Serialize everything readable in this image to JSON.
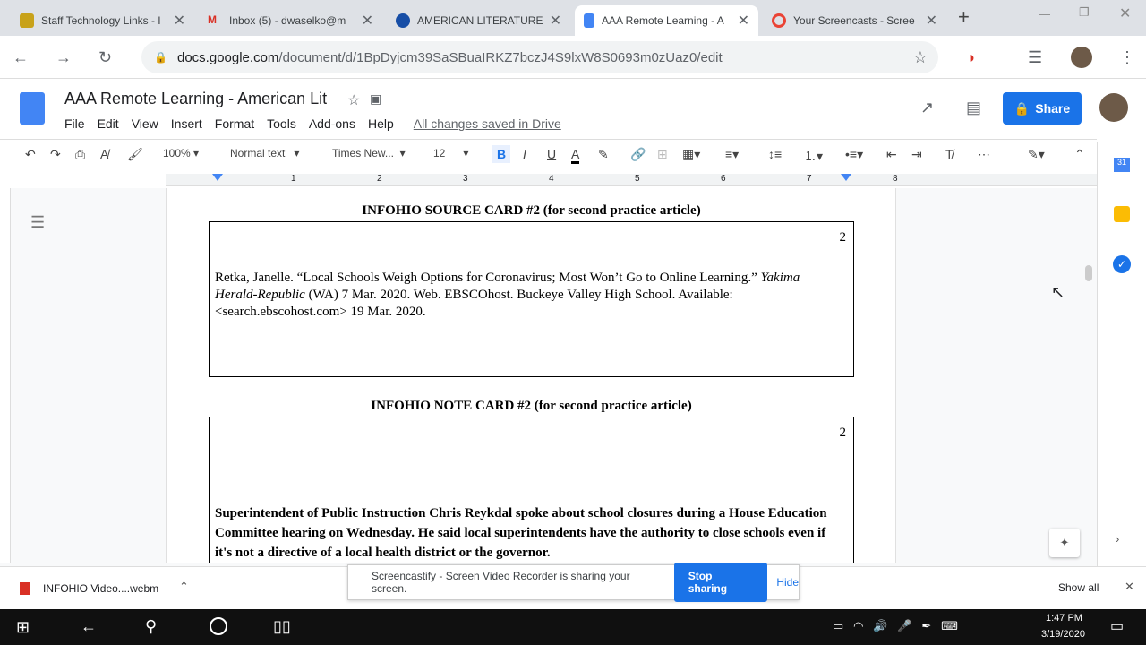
{
  "browser": {
    "tabs": [
      {
        "title": "Staff Technology Links - I",
        "color": "#c8a21a"
      },
      {
        "title": "Inbox (5) - dwaselko@m",
        "color": "#d93025"
      },
      {
        "title": "AMERICAN LITERATURE",
        "color": "#174ea6"
      },
      {
        "title": "AAA Remote Learning - A",
        "color": "#4285f4",
        "active": true
      },
      {
        "title": "Your Screencasts - Scree",
        "color": "#ea4335"
      }
    ],
    "url_host": "docs.google.com",
    "url_path": "/document/d/1BpDyjcm39SaSBuaIRKZ7bczJ4S9lxW8S0693m0zUaz0/edit"
  },
  "doc": {
    "title": "AAA Remote Learning - American Lit",
    "menu": [
      "File",
      "Edit",
      "View",
      "Insert",
      "Format",
      "Tools",
      "Add-ons",
      "Help"
    ],
    "saved": "All changes saved in Drive",
    "share": "Share",
    "toolbar": {
      "zoom": "100%",
      "style": "Normal text",
      "font": "Times New...",
      "size": "12"
    },
    "ruler": [
      "1",
      "2",
      "3",
      "4",
      "5",
      "6",
      "7",
      "8"
    ],
    "source_title": "INFOHIO SOURCE CARD #2 (for second practice article)",
    "source_num": "2",
    "source_text_1": "Retka, Janelle. “Local Schools Weigh Options for Coronavirus; Most Won’t Go to Online Learning.” ",
    "source_italic_1": "Yakima Herald-Republic",
    "source_text_2": " (WA)  7 Mar. 2020.  Web.  EBSCOhost.  Buckeye Valley High School.  Available: <search.ebscohost.com> 19 Mar. 2020.",
    "note_title": "INFOHIO NOTE CARD #2 (for second practice article)",
    "note_num": "2",
    "note_text": "Superintendent of Public Instruction Chris Reykdal spoke about school closures during a House Education Committee hearing on Wednesday. He said local superintendents have the authority to close schools even if it's not a directive of a local health district or the governor."
  },
  "downloads": {
    "file": "INFOHIO Video....webm",
    "show_all": "Show all"
  },
  "screencast": {
    "message": "Screencastify - Screen Video Recorder is sharing your screen.",
    "stop": "Stop sharing",
    "hide": "Hide"
  },
  "taskbar": {
    "time": "1:47 PM",
    "date": "3/19/2020"
  }
}
